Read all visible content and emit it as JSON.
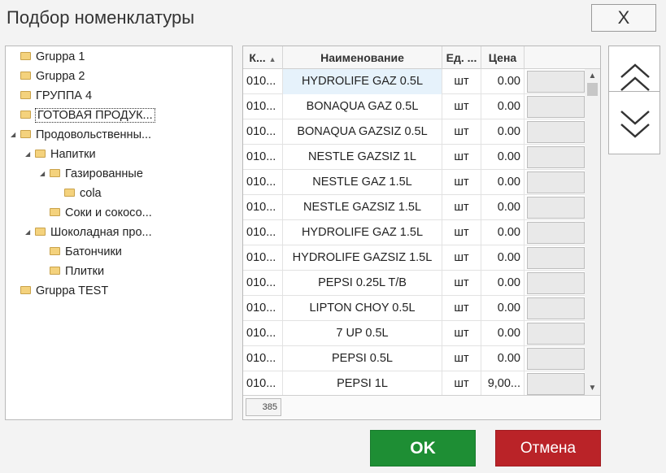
{
  "window": {
    "title": "Подбор номенклатуры",
    "close_label": "X"
  },
  "tree": {
    "items": [
      {
        "label": "Gruppa 1",
        "depth": 0,
        "expandable": false
      },
      {
        "label": "Gruppa 2",
        "depth": 0,
        "expandable": false
      },
      {
        "label": "ГРУППА 4",
        "depth": 0,
        "expandable": false
      },
      {
        "label": "ГОТОВАЯ ПРОДУК...",
        "depth": 0,
        "expandable": false,
        "selected": true
      },
      {
        "label": "Продовольственны...",
        "depth": 0,
        "expandable": true
      },
      {
        "label": "Напитки",
        "depth": 1,
        "expandable": true
      },
      {
        "label": "Газированные",
        "depth": 2,
        "expandable": true
      },
      {
        "label": "cola",
        "depth": 3,
        "expandable": false
      },
      {
        "label": "Соки и сокосо...",
        "depth": 2,
        "expandable": false
      },
      {
        "label": "Шоколадная про...",
        "depth": 1,
        "expandable": true
      },
      {
        "label": "Батончики",
        "depth": 2,
        "expandable": false
      },
      {
        "label": "Плитки",
        "depth": 2,
        "expandable": false
      },
      {
        "label": "Gruppa TEST",
        "depth": 0,
        "expandable": false
      }
    ]
  },
  "grid": {
    "columns": {
      "code": "К...",
      "name": "Наименование",
      "unit": "Ед. ...",
      "price": "Цена"
    },
    "rows": [
      {
        "code": "010...",
        "name": "HYDROLIFE GAZ 0.5L",
        "unit": "шт",
        "price": "0.00"
      },
      {
        "code": "010...",
        "name": "BONAQUA GAZ 0.5L",
        "unit": "шт",
        "price": "0.00"
      },
      {
        "code": "010...",
        "name": "BONAQUA GAZSIZ 0.5L",
        "unit": "шт",
        "price": "0.00"
      },
      {
        "code": "010...",
        "name": "NESTLE GAZSIZ 1L",
        "unit": "шт",
        "price": "0.00"
      },
      {
        "code": "010...",
        "name": "NESTLE GAZ 1.5L",
        "unit": "шт",
        "price": "0.00"
      },
      {
        "code": "010...",
        "name": "NESTLE GAZSIZ 1.5L",
        "unit": "шт",
        "price": "0.00"
      },
      {
        "code": "010...",
        "name": "HYDROLIFE GAZ 1.5L",
        "unit": "шт",
        "price": "0.00"
      },
      {
        "code": "010...",
        "name": "HYDROLIFE GAZSIZ 1.5L",
        "unit": "шт",
        "price": "0.00"
      },
      {
        "code": "010...",
        "name": "PEPSI 0.25L T/B",
        "unit": "шт",
        "price": "0.00"
      },
      {
        "code": "010...",
        "name": "LIPTON CHOY 0.5L",
        "unit": "шт",
        "price": "0.00"
      },
      {
        "code": "010...",
        "name": "7 UP 0.5L",
        "unit": "шт",
        "price": "0.00"
      },
      {
        "code": "010...",
        "name": "PEPSI 0.5L",
        "unit": "шт",
        "price": "0.00"
      },
      {
        "code": "010...",
        "name": "PEPSI 1L",
        "unit": "шт",
        "price": "9,00..."
      }
    ],
    "count": "385"
  },
  "actions": {
    "ok_label": "OK",
    "cancel_label": "Отмена"
  },
  "colors": {
    "ok": "#1e8e34",
    "cancel": "#ba2328",
    "folder": "#f4d27d",
    "row_selected": "#e6f2fb"
  }
}
